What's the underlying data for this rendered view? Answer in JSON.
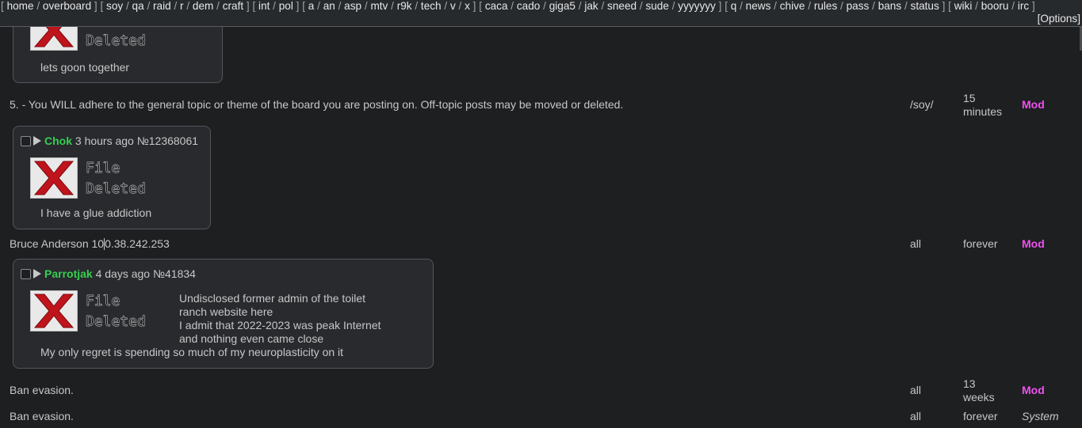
{
  "nav": {
    "groups": [
      [
        "home",
        "overboard"
      ],
      [
        "soy",
        "qa",
        "raid",
        "r",
        "dem",
        "craft"
      ],
      [
        "int",
        "pol"
      ],
      [
        "a",
        "an",
        "asp",
        "mtv",
        "r9k",
        "tech",
        "v",
        "x"
      ],
      [
        "caca",
        "cado",
        "giga5",
        "jak",
        "sneed",
        "sude",
        "yyyyyyy"
      ],
      [
        "q",
        "news",
        "chive",
        "rules",
        "pass",
        "bans",
        "status"
      ],
      [
        "wiki",
        "booru",
        "irc"
      ]
    ],
    "options_label": "[Options]"
  },
  "thumbnail": {
    "line1": "File",
    "line2": "Deleted",
    "icon": "deleted-file-x-icon",
    "red": "#c0141c"
  },
  "posts": [
    {
      "body": [
        "lets goon together"
      ]
    },
    {
      "name": "Chok",
      "time": "3 hours ago",
      "number": "№12368061",
      "body": [
        "I have a glue addiction"
      ]
    },
    {
      "name": "Parrotjak",
      "time": "4 days ago",
      "number": "№41834",
      "side_text": [
        "Undisclosed former admin of the toilet",
        "ranch website here",
        "I admit that 2022-2023 was peak Internet",
        "and nothing even came close"
      ],
      "body": [
        "My only regret is spending so much of my neuroplasticity on it"
      ]
    }
  ],
  "bans": [
    {
      "reason": "5. - You WILL adhere to the general topic or theme of the board you are posting on. Off-topic posts may be moved or deleted.",
      "board": "/soy/",
      "duration": [
        "15",
        "minutes"
      ],
      "by": "Mod"
    },
    {
      "reason_a": "Bruce Anderson 10",
      "reason_b": "0.38.242.253",
      "board": "all",
      "duration": [
        "forever"
      ],
      "by": "Mod"
    },
    {
      "reason": "Ban evasion.",
      "board": "all",
      "duration": [
        "13",
        "weeks"
      ],
      "by": "Mod"
    },
    {
      "reason": "Ban evasion.",
      "board": "all",
      "duration": [
        "forever"
      ],
      "by": "System"
    }
  ],
  "colors": {
    "background": "#1d1f21",
    "post_background": "#282a2e",
    "name": "#35d04f",
    "mod": "#f050f0"
  }
}
